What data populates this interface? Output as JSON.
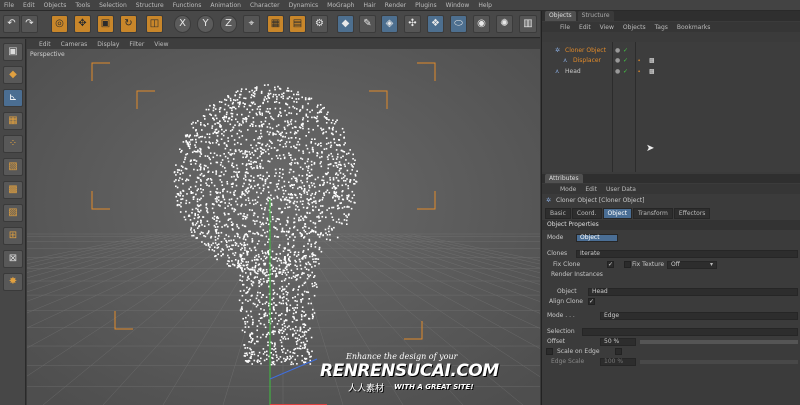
{
  "menu": [
    "File",
    "Edit",
    "Objects",
    "Tools",
    "Selection",
    "Structure",
    "Functions",
    "Animation",
    "Character",
    "Dynamics",
    "MoGraph",
    "Hair",
    "Render",
    "Plugins",
    "Window",
    "Help"
  ],
  "toolbar": {
    "axis_buttons": [
      "X",
      "Y",
      "Z"
    ]
  },
  "viewport": {
    "menu": [
      "Edit",
      "Cameras",
      "Display",
      "Filter",
      "View"
    ],
    "label": "Perspective"
  },
  "objects_panel": {
    "tabs": [
      "Objects",
      "Structure"
    ],
    "menu": [
      "File",
      "Edit",
      "View",
      "Objects",
      "Tags",
      "Bookmarks"
    ],
    "items": [
      {
        "name": "Cloner Object",
        "indent": 0,
        "color": "#e08a2a"
      },
      {
        "name": "Displacer",
        "indent": 1,
        "color": "#e08a2a"
      },
      {
        "name": "Head",
        "indent": 0,
        "color": "#bfbfbf"
      }
    ]
  },
  "attributes": {
    "title": "Attributes",
    "menu": [
      "Mode",
      "Edit",
      "User Data"
    ],
    "object_title": "Cloner Object [Cloner Object]",
    "tabs": [
      "Basic",
      "Coord.",
      "Object",
      "Transform",
      "Effectors"
    ],
    "active_tab": "Object",
    "section_title": "Object Properties",
    "mode_label": "Mode",
    "mode_value": "Object",
    "clones_label": "Clones",
    "clones_value": "Iterate",
    "fix_clone_label": "Fix Clone",
    "fix_texture_label": "Fix Texture",
    "fix_texture_value": "Off",
    "render_instances_label": "Render Instances",
    "object_label": "Object",
    "object_value": "Head",
    "align_clone_label": "Align Clone",
    "distribution_label": "Mode . . .",
    "distribution_value": "Edge",
    "selection_label": "Selection",
    "offset_label": "Offset",
    "offset_value": "50 %",
    "scale_on_edge_label": "Scale on Edge",
    "edge_scale_label": "Edge Scale",
    "edge_scale_value": "100 %"
  },
  "watermark": {
    "line1": "Enhance the design of your",
    "line2": "RENRENSUCAI.COM",
    "line3": "人人素材",
    "line4": "WITH A GREAT SITE!"
  },
  "colors": {
    "accent_orange": "#e08a2a",
    "tab_blue": "#4a6e95",
    "point_cloud": "#ffffff"
  }
}
